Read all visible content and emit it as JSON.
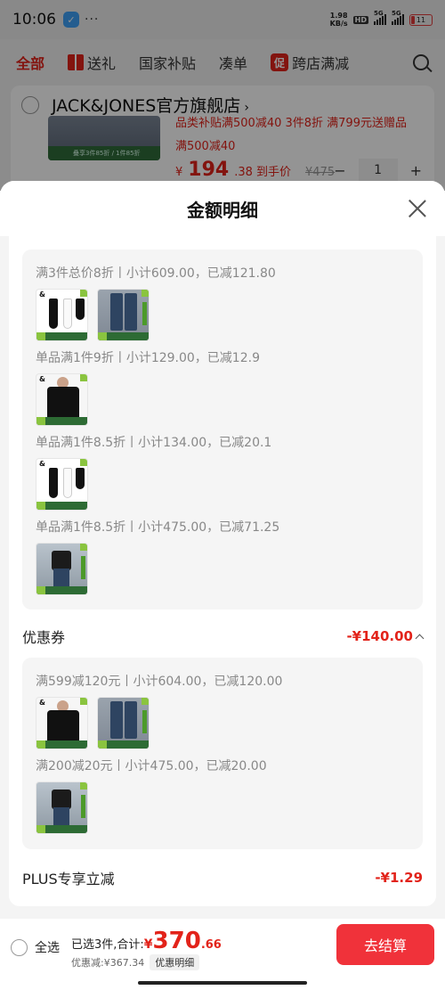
{
  "status": {
    "time": "10:06",
    "speed_top": "1.98",
    "speed_bottom": "KB/s",
    "hd": "HD",
    "net1": "5G",
    "net2": "5G",
    "battery": "11"
  },
  "tabs": [
    {
      "label": "全部"
    },
    {
      "label": "送礼",
      "icon": "gift-icon"
    },
    {
      "label": "国家补贴"
    },
    {
      "label": "凑单"
    },
    {
      "label": "跨店满减",
      "badge": "促"
    }
  ],
  "shop": {
    "name": "JACK&JONES官方旗舰店",
    "arrow": "›",
    "promo_line1": "品类补贴满500减40  3件8折  满799元送赠品",
    "promo_line2": "满500减40",
    "thumb_strip": "叠享3件85折 / 1件85折",
    "price_cur": "¥",
    "price_int": "194",
    "price_dec": ".38 到手价",
    "orig_price": "¥475",
    "qty": "1",
    "minus": "−",
    "plus": "+"
  },
  "sheet": {
    "title": "金额明细",
    "promo_groups": [
      {
        "text": "满3件总价8折丨小计609.00，已减121.80",
        "thumbs": [
          "socks",
          "jeans"
        ]
      },
      {
        "text": "单品满1件9折丨小计129.00，已减12.9",
        "thumbs": [
          "tshirt"
        ]
      },
      {
        "text": "单品满1件8.5折丨小计134.00，已减20.1",
        "thumbs": [
          "socks"
        ]
      },
      {
        "text": "单品满1件8.5折丨小计475.00，已减71.25",
        "thumbs": [
          "man"
        ]
      }
    ],
    "coupon": {
      "label": "优惠券",
      "amount": "-¥140.00"
    },
    "coupon_groups": [
      {
        "text": "满599减120元丨小计604.00，已减120.00",
        "thumbs": [
          "tshirt",
          "jeans"
        ]
      },
      {
        "text": "满200减20元丨小计475.00，已减20.00",
        "thumbs": [
          "man"
        ]
      }
    ],
    "plus": {
      "label": "PLUS专享立减",
      "amount": "-¥1.29"
    }
  },
  "bottom": {
    "select_all": "全选",
    "selected": "已选3件,合计:",
    "total_cur": "¥",
    "total_int": "370",
    "total_dec": ".66",
    "discount": "优惠减:¥367.34",
    "detail_btn": "优惠明细",
    "checkout": "去结算"
  },
  "colors": {
    "accent": "#e2231a",
    "checkout": "#f0323a",
    "promo_tag_green": "#2d6b34"
  }
}
